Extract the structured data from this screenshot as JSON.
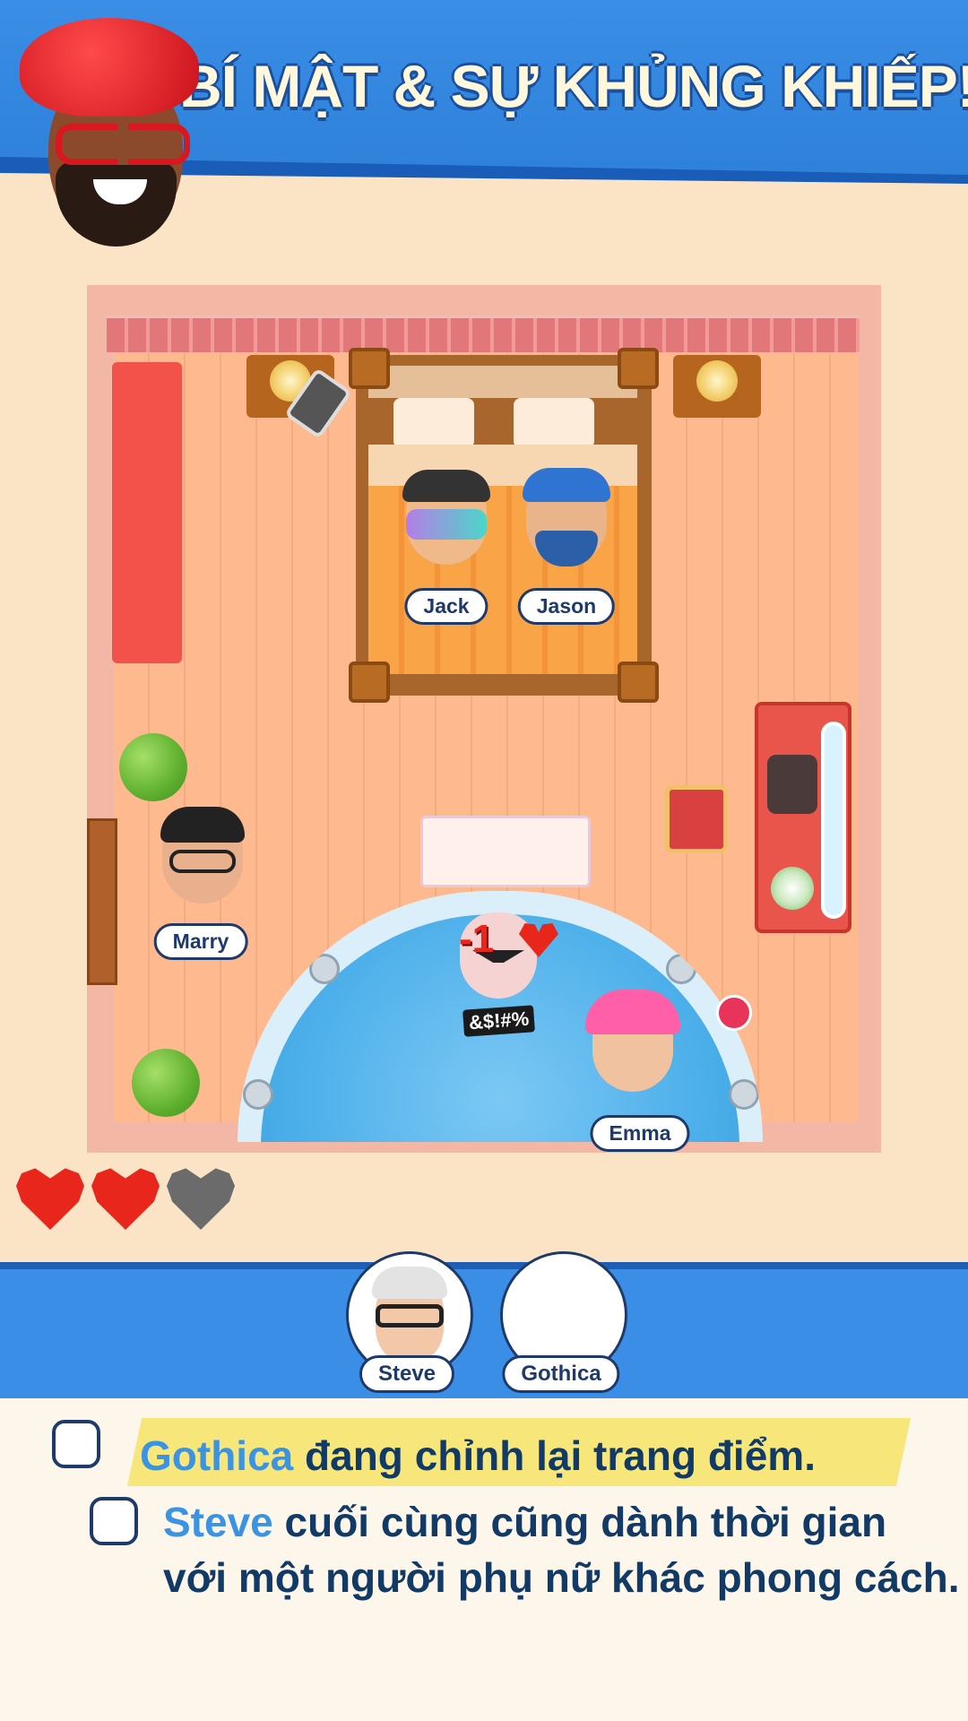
{
  "header": {
    "title": "BÍ MẬT & SỰ KHỦNG KHIẾP!"
  },
  "room": {
    "characters": [
      {
        "name": "Jack"
      },
      {
        "name": "Jason"
      },
      {
        "name": "Marry"
      },
      {
        "name": "Emma"
      }
    ],
    "reaction": {
      "score": "-1",
      "curse": "&$!#%"
    }
  },
  "lives": {
    "total": 3,
    "remaining": 2,
    "full_color": "#e8261b",
    "empty_color": "#6b6b6b"
  },
  "suspects": [
    {
      "name": "Steve"
    },
    {
      "name": "Gothica"
    }
  ],
  "clues": [
    {
      "subject": "Gothica",
      "text": " đang chỉnh lại trang điểm.",
      "checked": false
    },
    {
      "subject": "Steve",
      "text_line1": " cuối cùng cũng dành thời gian",
      "text_line2": "với một người phụ nữ khác phong cách.",
      "checked": false
    }
  ],
  "colors": {
    "accent_blue": "#3a8ee6",
    "navy": "#123a66",
    "highlight": "#f7e67a"
  }
}
